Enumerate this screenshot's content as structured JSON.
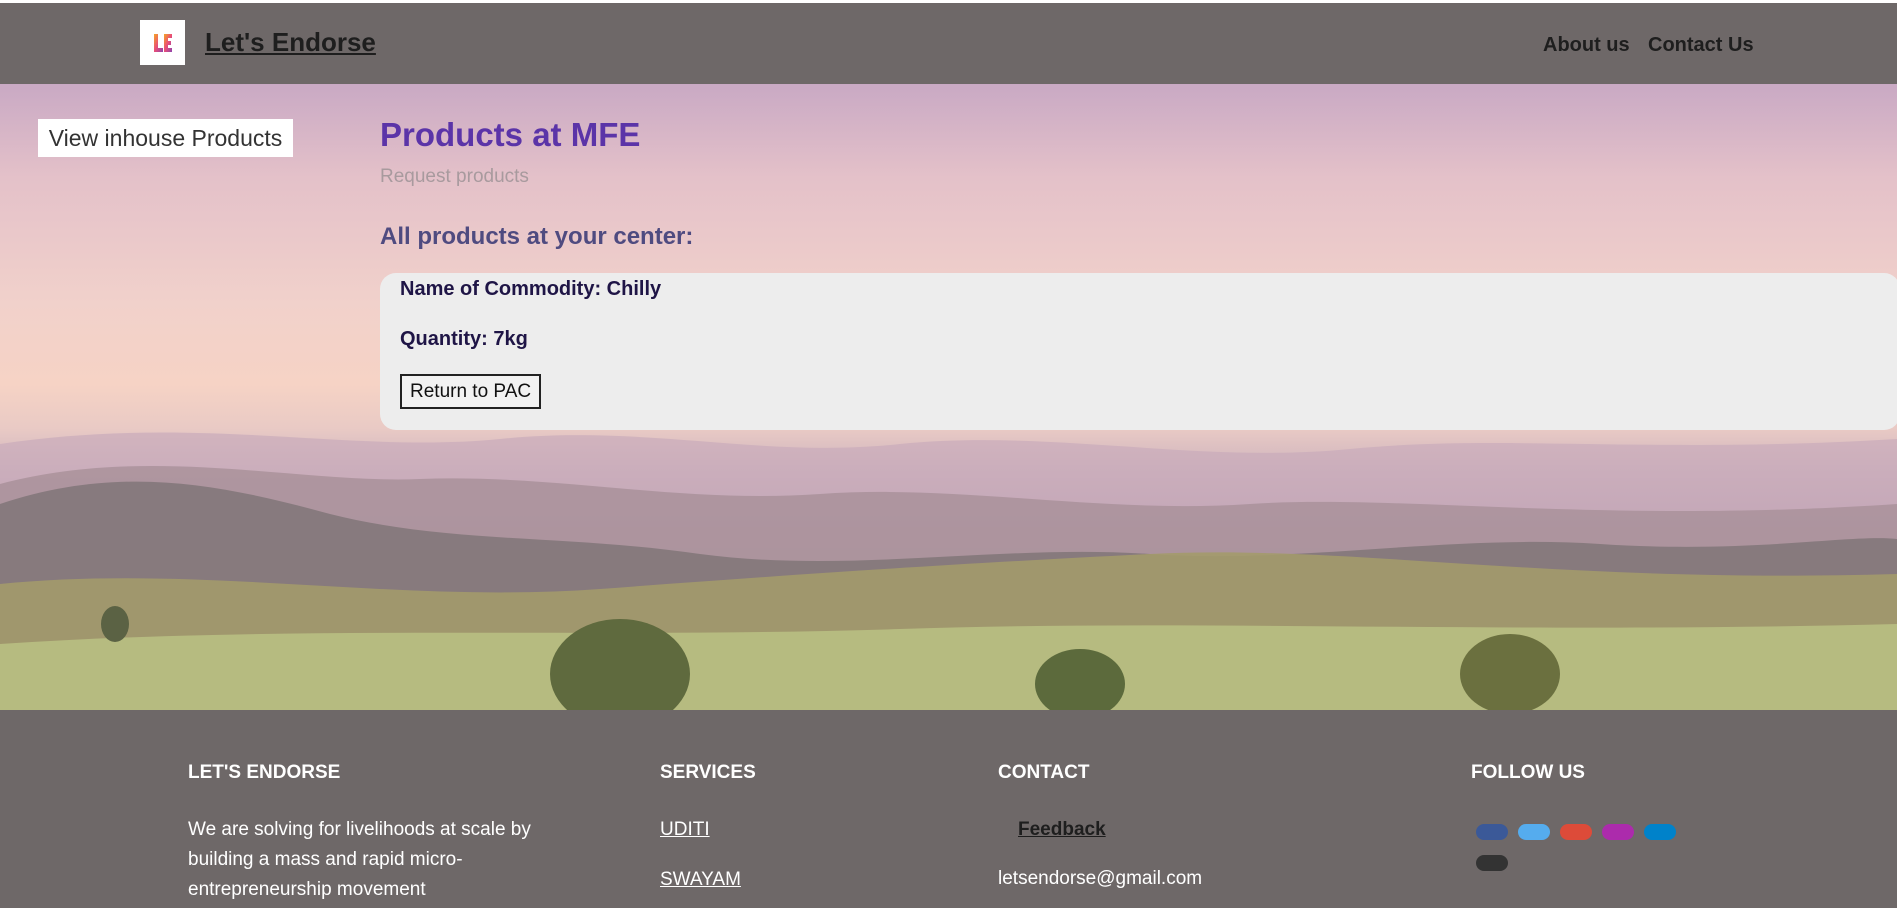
{
  "header": {
    "brand": "Let's Endorse",
    "nav": [
      "About us",
      "Contact Us"
    ]
  },
  "sidebar": {
    "view_button": "View inhouse Products"
  },
  "main": {
    "title": "Products at MFE",
    "subtitle": "Request products",
    "section_title": "All products at your center:",
    "product": {
      "commodity": "Name of Commodity: Chilly",
      "quantity": "Quantity: 7kg",
      "return_button": "Return to PAC"
    }
  },
  "footer": {
    "about": {
      "heading": "LET'S ENDORSE",
      "text_lines": [
        "We are solving for livelihoods at scale by",
        "building a mass and rapid micro-",
        "entrepreneurship movement"
      ]
    },
    "services": {
      "heading": "SERVICES",
      "links": [
        "UDITI",
        "SWAYAM"
      ]
    },
    "contact": {
      "heading": "CONTACT",
      "feedback": "Feedback",
      "email": "letsendorse@gmail.com"
    },
    "follow": {
      "heading": "FOLLOW US",
      "icons": [
        {
          "name": "facebook-icon",
          "color": "#3b5998"
        },
        {
          "name": "twitter-icon",
          "color": "#55acee"
        },
        {
          "name": "google-icon",
          "color": "#dd4b39"
        },
        {
          "name": "instagram-icon",
          "color": "#ac2bac"
        },
        {
          "name": "linkedin-icon",
          "color": "#0082ca"
        },
        {
          "name": "github-icon",
          "color": "#333333"
        }
      ]
    }
  },
  "colors": {
    "header_bg": "#6e6868",
    "title": "#5b34a8",
    "card_bg": "#ededed"
  }
}
